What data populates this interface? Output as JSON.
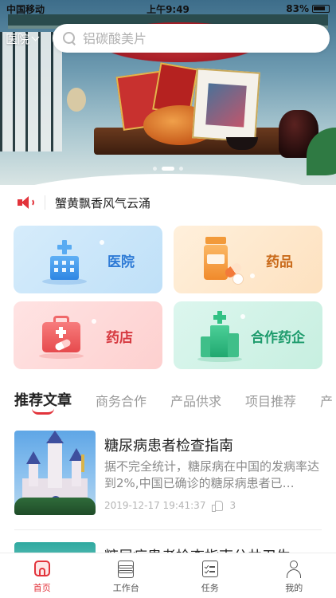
{
  "status_bar": {
    "carrier": "中国移动",
    "time": "上午9:49",
    "battery": "83%"
  },
  "header": {
    "city_label": "医院",
    "search_placeholder": "铝碳酸美片"
  },
  "banner": {
    "slides": 3,
    "active_slide": 2
  },
  "notice": {
    "icon": "speaker-icon",
    "text": "蟹黄飘香风气云涌"
  },
  "categories": [
    {
      "label": "医院",
      "icon": "hospital-icon",
      "color": "#2f7bd6"
    },
    {
      "label": "药品",
      "icon": "medicine-bottle-icon",
      "color": "#c96a1a"
    },
    {
      "label": "药店",
      "icon": "pharmacy-kit-icon",
      "color": "#d6383f"
    },
    {
      "label": "合作药企",
      "icon": "pharma-company-icon",
      "color": "#1d9b6c"
    }
  ],
  "tabs": [
    {
      "label": "推荐文章",
      "active": true
    },
    {
      "label": "商务合作",
      "active": false
    },
    {
      "label": "产品供求",
      "active": false
    },
    {
      "label": "项目推荐",
      "active": false
    },
    {
      "label": "产",
      "active": false
    }
  ],
  "articles": [
    {
      "title": "糖尿病患者检查指南",
      "summary": "据不完全统计，糖尿病在中国的发病率达到2%,中国已确诊的糖尿病患者已…",
      "date": "2019-12-17 19:41:37",
      "likes": "3"
    },
    {
      "title": "糖尿病患者检查指南公共卫生"
    }
  ],
  "bottom_nav": [
    {
      "label": "首页",
      "icon": "home-icon",
      "active": true
    },
    {
      "label": "工作台",
      "icon": "layers-icon",
      "active": false
    },
    {
      "label": "任务",
      "icon": "task-icon",
      "active": false
    },
    {
      "label": "我的",
      "icon": "user-icon",
      "active": false
    }
  ],
  "colors": {
    "accent": "#e2333b"
  }
}
